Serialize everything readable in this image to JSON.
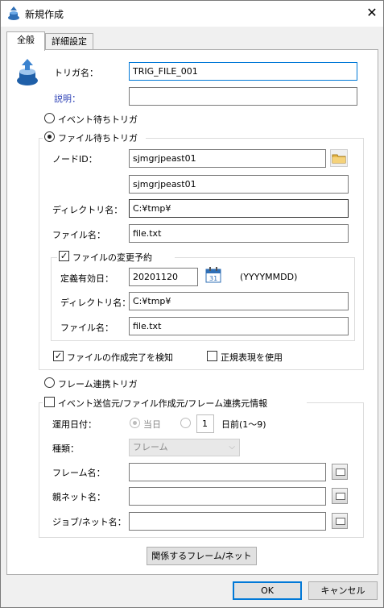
{
  "window": {
    "title": "新規作成",
    "icon": "jp1-app-icon",
    "close_icon": "close-icon"
  },
  "tabs": [
    {
      "label": "全般",
      "active": true
    },
    {
      "label": "詳細設定",
      "active": false
    }
  ],
  "general": {
    "trigger_name_label": "トリガ名：",
    "trigger_name_value": "TRIG_FILE_001",
    "description_label": "説明：",
    "description_value": "",
    "event_trigger_label": "イベント待ちトリガ",
    "file_trigger_label": "ファイル待ちトリガ",
    "frame_trigger_label": "フレーム連携トリガ",
    "selected_trigger": "file"
  },
  "file_trigger": {
    "node_id_label": "ノードID：",
    "node_id_value": "sjmgrjpeast01",
    "node_id_value2": "sjmgrjpeast01",
    "directory_label": "ディレクトリ名：",
    "directory_value": "C:¥tmp¥",
    "file_label": "ファイル名：",
    "file_value": "file.txt",
    "change_reservation_label": "ファイルの変更予約",
    "change_reservation_checked": true,
    "effective_date_label": "定義有効日：",
    "effective_date_value": "20201120",
    "date_format": "(YYYYMMDD)",
    "reserve_directory_label": "ディレクトリ名：",
    "reserve_directory_value": "C:¥tmp¥",
    "reserve_file_label": "ファイル名：",
    "reserve_file_value": "file.txt",
    "detect_complete_label": "ファイルの作成完了を検知",
    "detect_complete_checked": true,
    "use_regex_label": "正規表現を使用",
    "use_regex_checked": false
  },
  "event_source": {
    "header_label": "イベント送信元/ファイル作成元/フレーム連携元情報",
    "checked": false,
    "operation_date_label": "運用日付：",
    "today_label": "当日",
    "days_value": "1",
    "days_before_label": "日前(1〜9)",
    "type_label": "種類：",
    "type_value": "フレーム",
    "frame_name_label": "フレーム名：",
    "frame_name_value": "",
    "parent_net_label": "親ネット名：",
    "parent_net_value": "",
    "job_net_label": "ジョブ/ネット名：",
    "job_net_value": ""
  },
  "buttons": {
    "related_frame_net": "関係するフレーム/ネット",
    "ok": "OK",
    "cancel": "キャンセル"
  },
  "colors": {
    "accent": "#0078d7",
    "description_label": "#2b3fb5"
  }
}
